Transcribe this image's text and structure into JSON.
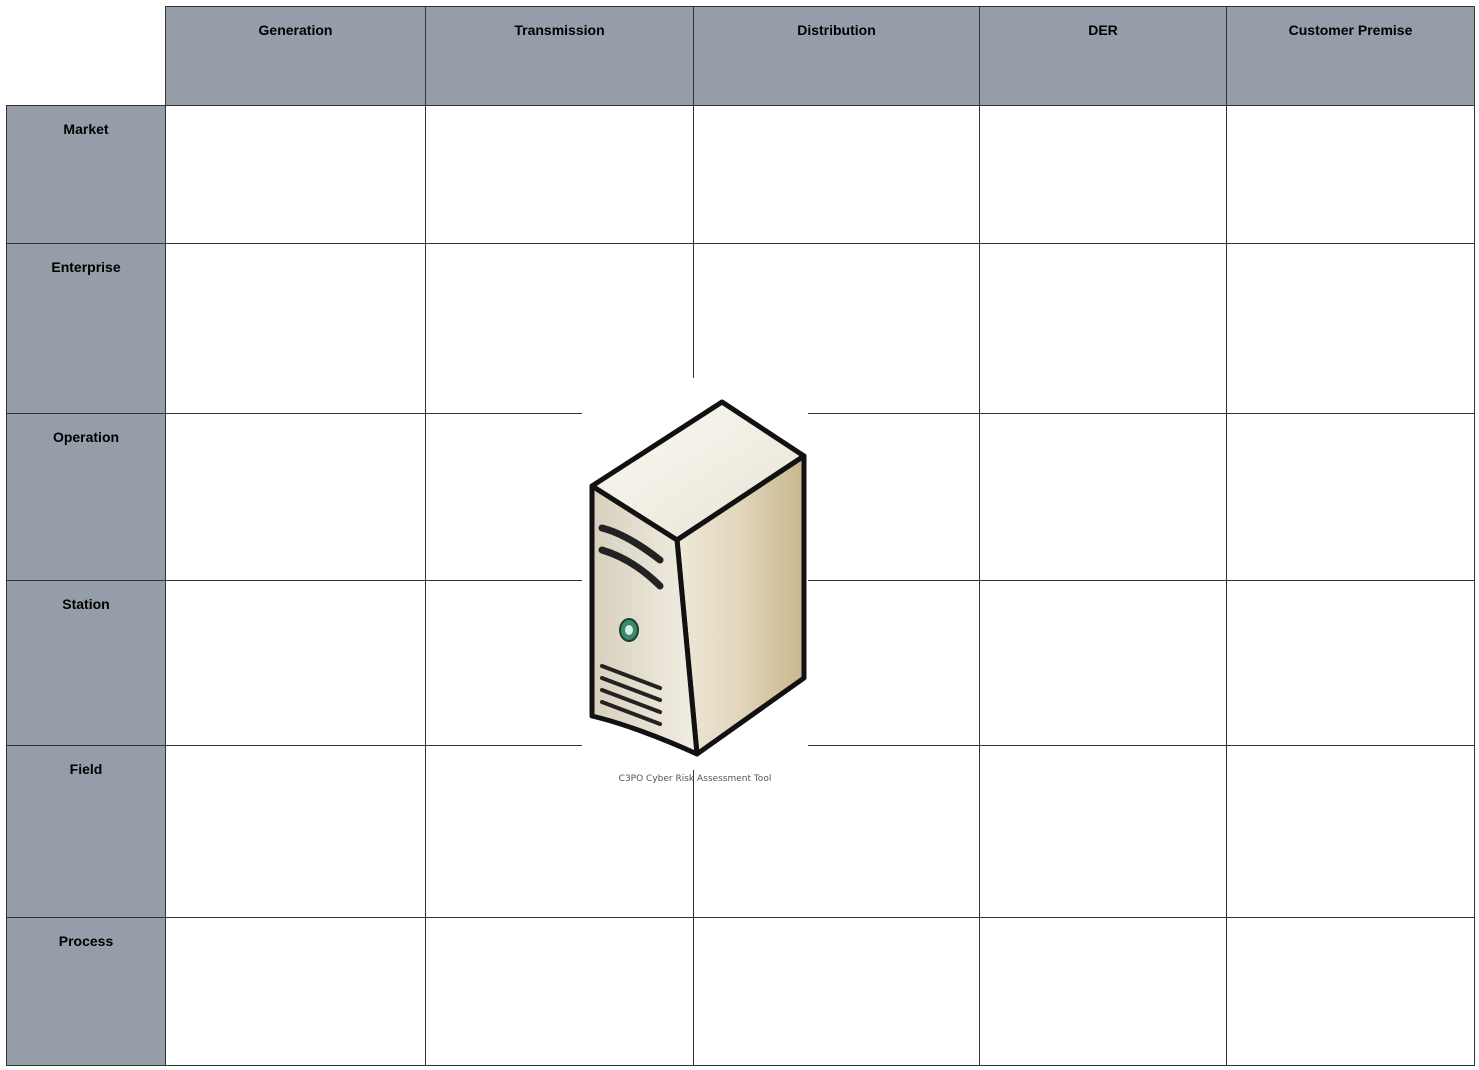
{
  "columns": [
    "Generation",
    "Transmission",
    "Distribution",
    "DER",
    "Customer Premise"
  ],
  "rows": [
    "Market",
    "Enterprise",
    "Operation",
    "Station",
    "Field",
    "Process"
  ],
  "figure": {
    "icon": "server-tower-icon",
    "caption": "C3PO Cyber Risk Assessment Tool"
  },
  "colors": {
    "header_fill": "#959da8",
    "grid_line": "#333333",
    "cell_fill": "#ffffff"
  }
}
